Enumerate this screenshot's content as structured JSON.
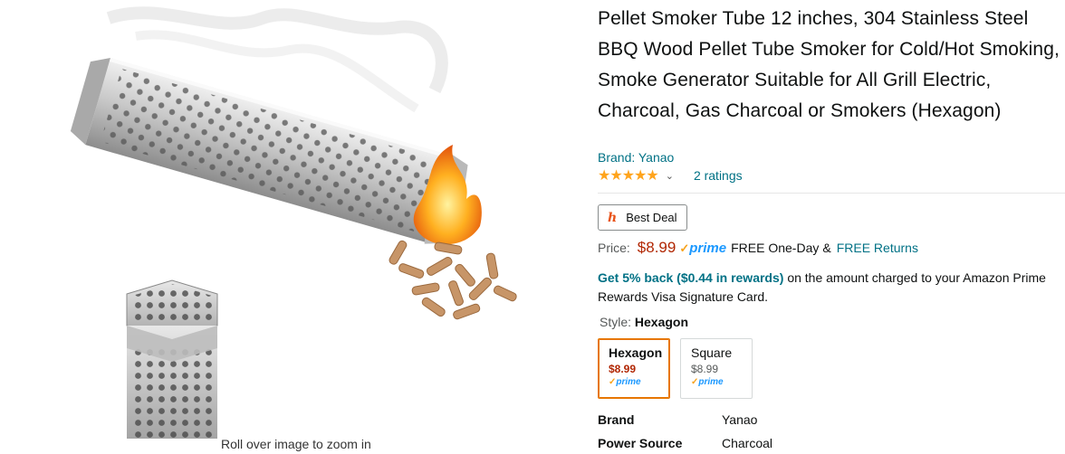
{
  "product": {
    "title": "Pellet Smoker Tube 12 inches, 304 Stainless Steel BBQ Wood Pellet Tube Smoker for Cold/Hot Smoking, Smoke Generator Suitable for All Grill Electric, Charcoal, Gas Charcoal or Smokers (Hexagon)",
    "brand_link": "Brand: Yanao",
    "stars": "★★★★★",
    "ratings_link": "2 ratings"
  },
  "images": {
    "zoom_hint": "Roll over image to zoom in"
  },
  "badge": {
    "label": "Best Deal",
    "icon_glyph": "h"
  },
  "price": {
    "label": "Price:",
    "value": "$8.99",
    "prime_check": "✓",
    "prime_word": "prime",
    "free_oneday": "FREE One-Day",
    "amp": "&",
    "free_returns": "FREE Returns"
  },
  "rewards": {
    "highlight": "Get 5% back ($0.44 in rewards)",
    "rest": " on the amount charged to your Amazon Prime Rewards Visa Signature Card."
  },
  "style": {
    "label": "Style:",
    "selected": "Hexagon",
    "options": [
      {
        "name": "Hexagon",
        "price": "$8.99",
        "prime": "prime"
      },
      {
        "name": "Square",
        "price": "$8.99",
        "prime": "prime"
      }
    ]
  },
  "specs": [
    {
      "key": "Brand",
      "value": "Yanao"
    },
    {
      "key": "Power Source",
      "value": "Charcoal"
    }
  ],
  "colors": {
    "link": "#007185",
    "price": "#b12704",
    "star": "#ffa41c",
    "prime_blue": "#1a98ff",
    "selected_border": "#e77600"
  }
}
